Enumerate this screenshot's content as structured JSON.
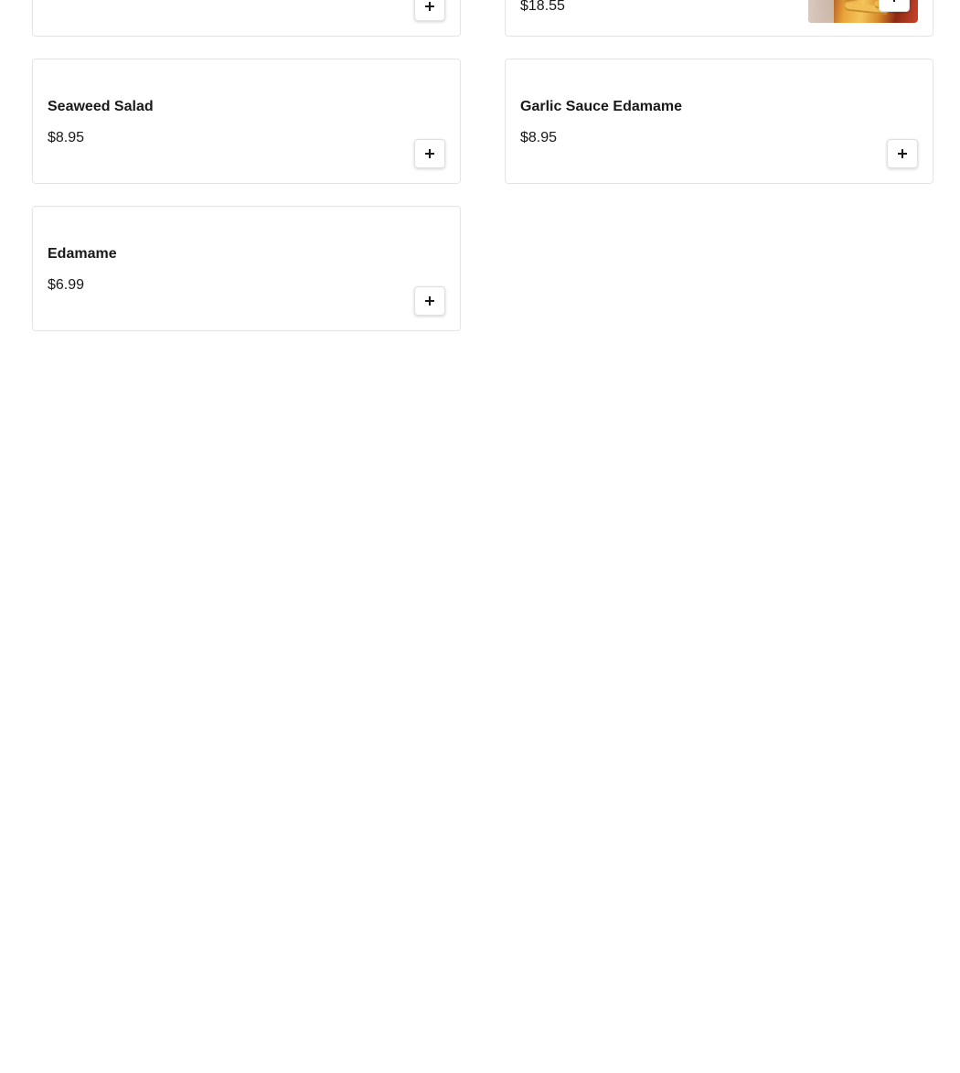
{
  "menu": {
    "items": [
      {
        "name": "",
        "price": "",
        "add_icon": "plus-icon"
      },
      {
        "name": "",
        "price": "$18.55",
        "add_icon": "plus-icon",
        "has_image": true
      },
      {
        "name": "Seaweed Salad",
        "price": "$8.95",
        "add_icon": "plus-icon"
      },
      {
        "name": "Garlic Sauce Edamame",
        "price": "$8.95",
        "add_icon": "plus-icon"
      },
      {
        "name": "Edamame",
        "price": "$6.99",
        "add_icon": "plus-icon"
      }
    ]
  },
  "colors": {
    "text": "#191919",
    "card_border": "#e4e4e4",
    "background": "#ffffff"
  }
}
